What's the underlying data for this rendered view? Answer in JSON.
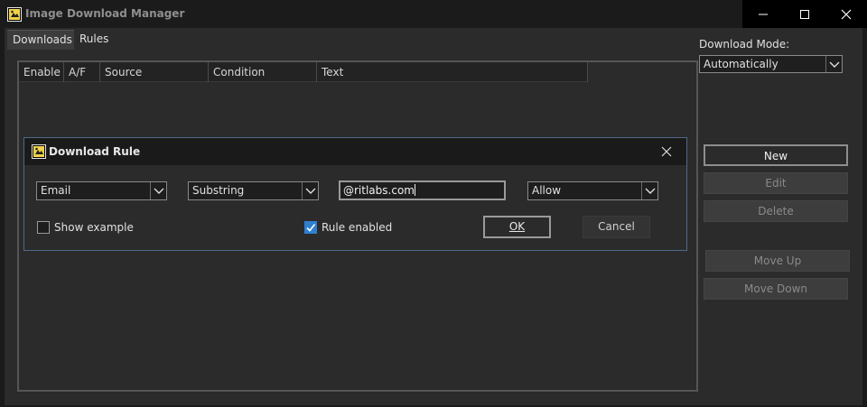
{
  "window": {
    "title": "Image Download Manager"
  },
  "tabs": [
    {
      "label": "Downloads"
    },
    {
      "label": "Rules"
    }
  ],
  "rules_table": {
    "columns": [
      "Enable",
      "A/F",
      "Source",
      "Condition",
      "Text"
    ]
  },
  "sidebar": {
    "mode_label": "Download Mode:",
    "mode_value": "Automatically",
    "buttons": {
      "new": "New",
      "edit": "Edit",
      "delete": "Delete",
      "move_up": "Move Up",
      "move_down": "Move Down"
    }
  },
  "dialog": {
    "title": "Download Rule",
    "source_value": "Email",
    "condition_value": "Substring",
    "text_value": "@ritlabs.com",
    "action_value": "Allow",
    "show_example_label": "Show example",
    "show_example_checked": false,
    "rule_enabled_label": "Rule enabled",
    "rule_enabled_checked": true,
    "ok_label": "OK",
    "cancel_label": "Cancel"
  },
  "colors": {
    "accent": "#2f7fd1",
    "background": "#2b2b2b",
    "titlebar": "#1b1b1b"
  }
}
